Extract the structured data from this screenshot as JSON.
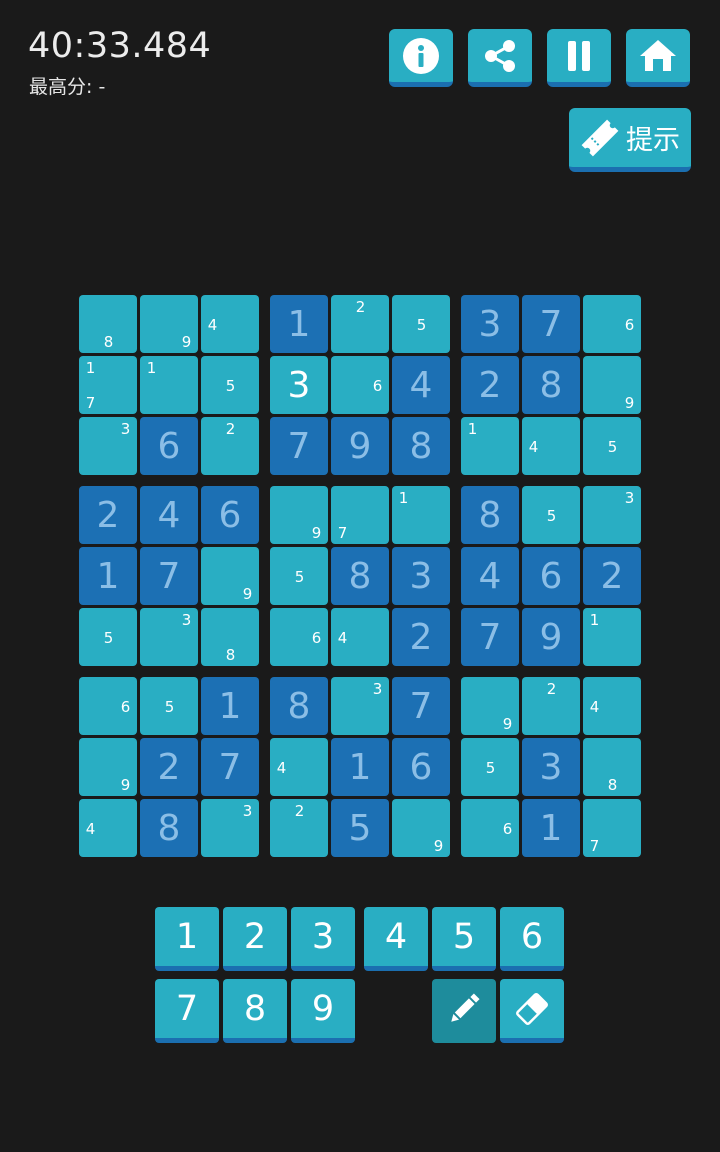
{
  "header": {
    "timer": "40:33.484",
    "best_score": "最高分: -"
  },
  "toolbar": {
    "buttons": [
      {
        "name": "info-button",
        "icon": "info-icon"
      },
      {
        "name": "share-button",
        "icon": "share-icon"
      },
      {
        "name": "pause-button",
        "icon": "pause-icon"
      },
      {
        "name": "home-button",
        "icon": "home-icon"
      }
    ],
    "hint_label": "提示"
  },
  "colors": {
    "background": "#1a1a1a",
    "light_cell": "#29aec3",
    "dark_cell": "#1c70b4",
    "given_digit": "#8bbee6",
    "entered_digit": "#ffffff"
  },
  "board": {
    "cells": [
      [
        {
          "n": [
            8
          ]
        },
        {
          "n": [
            9
          ]
        },
        {
          "n": [
            4
          ]
        },
        {
          "v": 1,
          "g": 1
        },
        {
          "n": [
            2
          ]
        },
        {
          "n": [
            5
          ]
        },
        {
          "v": 3,
          "g": 1
        },
        {
          "v": 7,
          "g": 1
        },
        {
          "n": [
            6
          ]
        }
      ],
      [
        {
          "n": [
            1,
            7
          ]
        },
        {
          "n": [
            1
          ]
        },
        {
          "n": [
            5
          ]
        },
        {
          "v": 3,
          "g": 0
        },
        {
          "n": [
            6
          ]
        },
        {
          "v": 4,
          "g": 1
        },
        {
          "v": 2,
          "g": 1
        },
        {
          "v": 8,
          "g": 1
        },
        {
          "n": [
            9
          ]
        }
      ],
      [
        {
          "n": [
            3
          ]
        },
        {
          "v": 6,
          "g": 1
        },
        {
          "n": [
            2
          ]
        },
        {
          "v": 7,
          "g": 1
        },
        {
          "v": 9,
          "g": 1
        },
        {
          "v": 8,
          "g": 1
        },
        {
          "n": [
            1
          ]
        },
        {
          "n": [
            4
          ]
        },
        {
          "n": [
            5
          ]
        }
      ],
      [
        {
          "v": 2,
          "g": 1
        },
        {
          "v": 4,
          "g": 1
        },
        {
          "v": 6,
          "g": 1
        },
        {
          "n": [
            9
          ]
        },
        {
          "n": [
            7
          ]
        },
        {
          "n": [
            1
          ]
        },
        {
          "v": 8,
          "g": 1
        },
        {
          "n": [
            5
          ]
        },
        {
          "n": [
            3
          ]
        }
      ],
      [
        {
          "v": 1,
          "g": 1
        },
        {
          "v": 7,
          "g": 1
        },
        {
          "n": [
            9
          ]
        },
        {
          "n": [
            5
          ]
        },
        {
          "v": 8,
          "g": 1
        },
        {
          "v": 3,
          "g": 1
        },
        {
          "v": 4,
          "g": 1
        },
        {
          "v": 6,
          "g": 1
        },
        {
          "v": 2,
          "g": 1
        }
      ],
      [
        {
          "n": [
            5
          ]
        },
        {
          "n": [
            3
          ]
        },
        {
          "n": [
            8
          ]
        },
        {
          "n": [
            6
          ]
        },
        {
          "n": [
            4
          ]
        },
        {
          "v": 2,
          "g": 1
        },
        {
          "v": 7,
          "g": 1
        },
        {
          "v": 9,
          "g": 1
        },
        {
          "n": [
            1
          ]
        }
      ],
      [
        {
          "n": [
            6
          ]
        },
        {
          "n": [
            5
          ]
        },
        {
          "v": 1,
          "g": 1
        },
        {
          "v": 8,
          "g": 1
        },
        {
          "n": [
            3
          ]
        },
        {
          "v": 7,
          "g": 1
        },
        {
          "n": [
            9
          ]
        },
        {
          "n": [
            2
          ]
        },
        {
          "n": [
            4
          ]
        }
      ],
      [
        {
          "n": [
            9
          ]
        },
        {
          "v": 2,
          "g": 1
        },
        {
          "v": 7,
          "g": 1
        },
        {
          "n": [
            4
          ]
        },
        {
          "v": 1,
          "g": 1
        },
        {
          "v": 6,
          "g": 1
        },
        {
          "n": [
            5
          ]
        },
        {
          "v": 3,
          "g": 1
        },
        {
          "n": [
            8
          ]
        }
      ],
      [
        {
          "n": [
            4
          ]
        },
        {
          "v": 8,
          "g": 1
        },
        {
          "n": [
            3
          ]
        },
        {
          "n": [
            2
          ]
        },
        {
          "v": 5,
          "g": 1
        },
        {
          "n": [
            9
          ]
        },
        {
          "n": [
            6
          ]
        },
        {
          "v": 1,
          "g": 1
        },
        {
          "n": [
            7
          ]
        }
      ]
    ]
  },
  "number_pad": {
    "row1": [
      "1",
      "2",
      "3",
      "4",
      "5",
      "6"
    ],
    "row2": [
      "7",
      "8",
      "9"
    ],
    "tools": [
      {
        "name": "pencil-button",
        "icon": "pencil-icon",
        "active": true
      },
      {
        "name": "eraser-button",
        "icon": "eraser-icon",
        "active": false
      }
    ]
  }
}
